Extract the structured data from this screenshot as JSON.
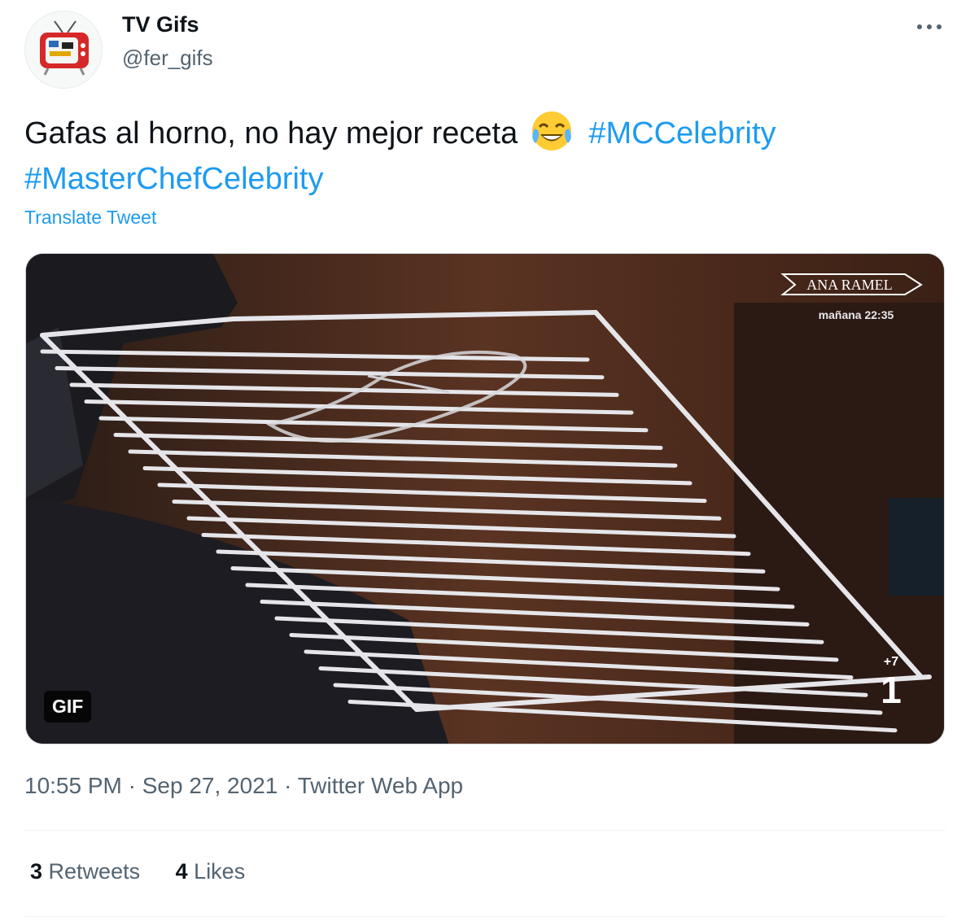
{
  "author": {
    "name": "TV Gifs",
    "handle": "@fer_gifs",
    "avatar_icon": "retro-tv-icon"
  },
  "tweet": {
    "text": "Gafas al horno, no hay mejor receta",
    "emoji_icon": "face-with-tears-of-joy-icon",
    "hashtags": [
      "#MCCelebrity",
      "#MasterChefCelebrity"
    ],
    "translate_label": "Translate Tweet"
  },
  "media": {
    "badge": "GIF",
    "overlay_title": "ANA RAMEL",
    "overlay_time": "mañana 22:35",
    "channel_logo": "1",
    "channel_plus": "+7"
  },
  "meta": {
    "time": "10:55 PM",
    "separator": "·",
    "date": "Sep 27, 2021",
    "source": "Twitter Web App"
  },
  "stats": {
    "retweets_count": "3",
    "retweets_label": "Retweets",
    "likes_count": "4",
    "likes_label": "Likes"
  },
  "colors": {
    "link": "#1d9bf0",
    "secondary_text": "#536471",
    "primary_text": "#0f1419"
  }
}
